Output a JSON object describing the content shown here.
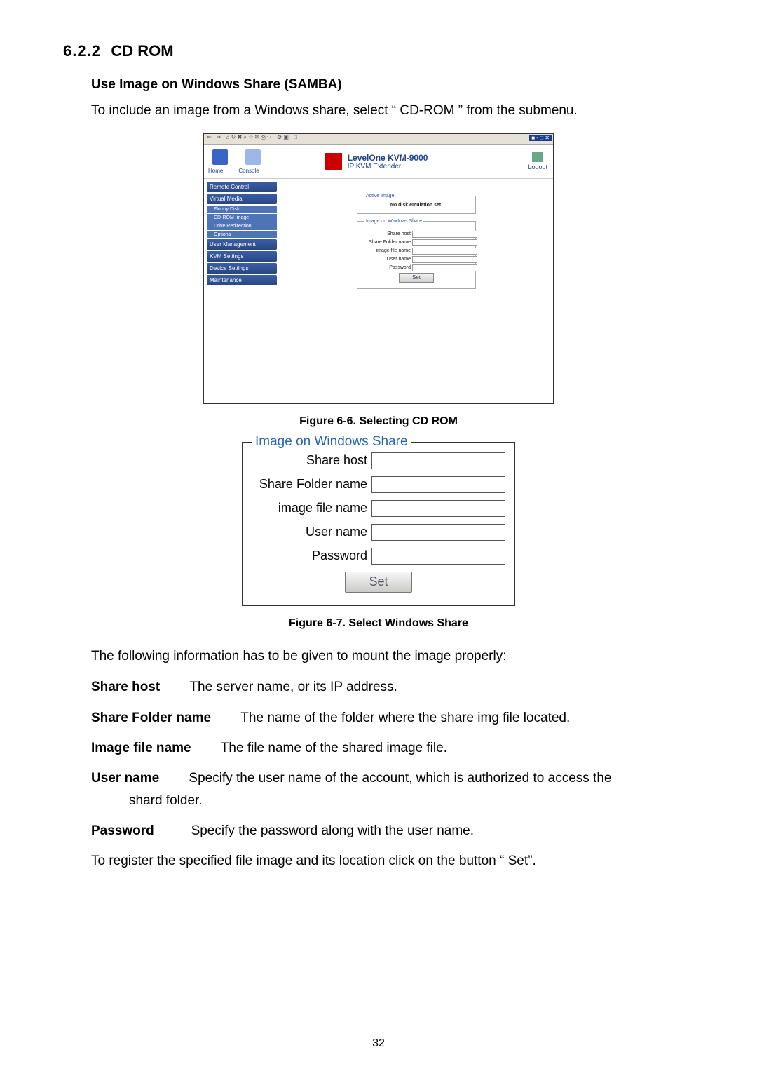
{
  "section": {
    "number": "6.2.2",
    "title": "CD ROM"
  },
  "subheading": "Use Image on Windows Share (SAMBA)",
  "intro": "To include an image from a Windows share, select “ CD-ROM ” from the submenu.",
  "screenshot": {
    "toolbar_glyphs": "⇦ · ⇨ · ⌂ ↻ ✖  ⌕ ☆ ✉ ⎙  ↪ · ⚙ ▣ · □",
    "window_btns": "■ - □ ✕",
    "header": {
      "home": "Home",
      "console": "Console",
      "product_title": "LevelOne KVM-9000",
      "product_sub": "IP KVM Extender",
      "logout": "Logout"
    },
    "sidebar": {
      "remote_control": "Remote Control",
      "virtual_media": "Virtual Media",
      "floppy_disk": "Floppy Disk",
      "cdrom_image": "CD-ROM Image",
      "drive_redirection": "Drive Redirection",
      "options": "Options",
      "user_management": "User Management",
      "kvm_settings": "KVM Settings",
      "device_settings": "Device Settings",
      "maintenance": "Maintenance"
    },
    "active_image": {
      "legend": "Active Image",
      "text": "No disk emulation set."
    },
    "form": {
      "legend": "Image on Windows Share",
      "share_host": "Share host",
      "share_folder": "Share Folder name",
      "image_file": "image file name",
      "user_name": "User name",
      "password": "Password",
      "set": "Set"
    }
  },
  "caption1": "Figure 6-6. Selecting CD ROM",
  "form2": {
    "legend": "Image on Windows Share",
    "share_host": "Share host",
    "share_folder": "Share Folder name",
    "image_file": "image file name",
    "user_name": "User name",
    "password": "Password",
    "set": "Set"
  },
  "caption2": "Figure 6-7. Select Windows Share",
  "after_fig_para": "The following information has to be given to mount the image properly:",
  "defs": {
    "share_host_t": "Share host",
    "share_host_d": "The server name, or its IP address.",
    "share_folder_t": "Share Folder name",
    "share_folder_d": "The name of the folder where the share img file located.",
    "image_file_t": "Image file name",
    "image_file_d": "The file name of the shared image file.",
    "user_name_t": "User name",
    "user_name_d1": "Specify the user name of the account, which is authorized to access the",
    "user_name_d2": "shard folder.",
    "password_t": "Password",
    "password_d": "Specify the password along with the user name."
  },
  "final_para": "To register the specified file image and its location click on the button “ Set”.",
  "page_number": "32"
}
